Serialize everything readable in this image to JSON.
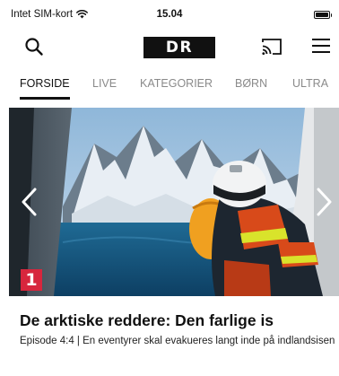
{
  "status_bar": {
    "carrier": "Intet SIM-kort",
    "time": "15.04",
    "battery_level": 0.9
  },
  "header": {
    "logo_text": "DR",
    "icons": [
      "search-icon",
      "cast-icon",
      "menu-icon"
    ]
  },
  "tabs": [
    {
      "label": "FORSIDE",
      "active": true
    },
    {
      "label": "LIVE",
      "active": false
    },
    {
      "label": "KATEGORIER",
      "active": false
    },
    {
      "label": "BØRN",
      "active": false
    },
    {
      "label": "ULTRA",
      "active": false
    }
  ],
  "hero": {
    "badge": "1",
    "title": "De arktiske reddere: Den farlige is",
    "subtitle": "Episode 4:4 | En eventyrer skal evakueres langt inde på indlandsisen"
  },
  "colors": {
    "badge": "#d7263d",
    "logo_bg": "#111111",
    "active_tab": "#111111",
    "inactive_tab": "#8a8a8a"
  }
}
